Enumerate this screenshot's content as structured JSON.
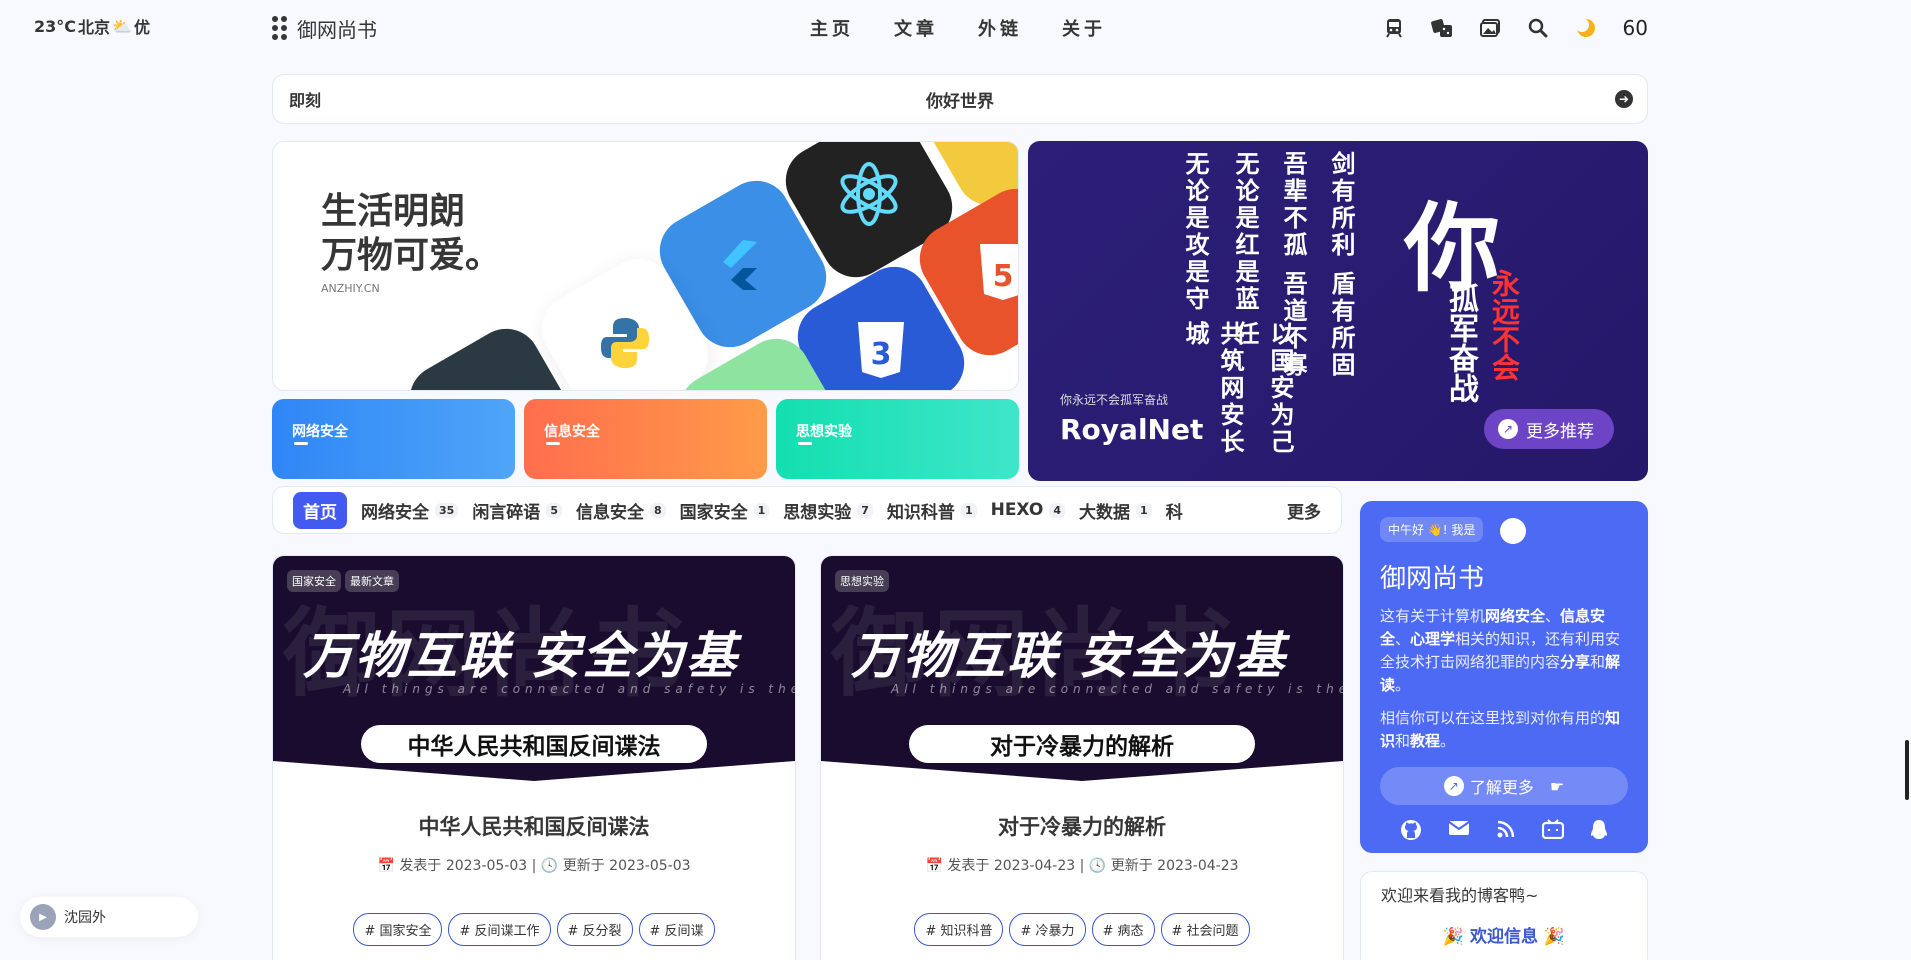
{
  "weather": {
    "temp": "23°C",
    "city": "北京",
    "aqi": "优"
  },
  "nav": {
    "brand": "御网尚书",
    "menu": [
      "主页",
      "文章",
      "外链",
      "关于"
    ],
    "count": "60"
  },
  "notice": {
    "label": "即刻",
    "message": "你好世界"
  },
  "hero": {
    "title_line1": "生活明朗",
    "title_line2": "万物可爱。",
    "site": "ANZHIY.CN"
  },
  "quick_cats": [
    {
      "label": "网络安全",
      "color": "#3a8ff7"
    },
    {
      "label": "信息安全",
      "color": "#ff7a45"
    },
    {
      "label": "思想实验",
      "color": "#1ed8b0"
    }
  ],
  "banner": {
    "poem": [
      "剑有所利",
      "盾有所固",
      "吾辈不孤",
      "吾道不寡",
      "无论是红是蓝",
      "以国安为己任",
      "无论是攻是守",
      "共筑网安长城"
    ],
    "headline_main": "你",
    "headline_side": "孤军奋战",
    "headline_red": "永远不会",
    "small": "你永远不会孤军奋战",
    "big": "RoyalNet",
    "more": "更多推荐"
  },
  "categories": [
    {
      "label": "首页",
      "count": ""
    },
    {
      "label": "网络安全",
      "count": "35"
    },
    {
      "label": "闲言碎语",
      "count": "5"
    },
    {
      "label": "信息安全",
      "count": "8"
    },
    {
      "label": "国家安全",
      "count": "1"
    },
    {
      "label": "思想实验",
      "count": "7"
    },
    {
      "label": "知识科普",
      "count": "1"
    },
    {
      "label": "HEXO",
      "count": "4"
    },
    {
      "label": "大数据",
      "count": "1"
    },
    {
      "label": "科",
      "count": ""
    }
  ],
  "categories_more": "更多",
  "posts": [
    {
      "badges": [
        "国家安全",
        "最新文章"
      ],
      "cover_ghost": "御网尚书",
      "cover_slogan": "万物互联 安全为基",
      "cover_sub": "All things are connected and safety is the foundation",
      "cover_pill": "中华人民共和国反间谍法",
      "title": "中华人民共和国反间谍法",
      "published_label": "发表于",
      "published": "2023-05-03",
      "updated_label": "更新于",
      "updated": "2023-05-03",
      "tags": [
        "# 国家安全",
        "# 反间谍工作",
        "# 反分裂",
        "# 反间谍"
      ]
    },
    {
      "badges": [
        "思想实验"
      ],
      "cover_ghost": "御网尚书",
      "cover_slogan": "万物互联 安全为基",
      "cover_sub": "All things are connected and safety is the foundation",
      "cover_pill": "对于冷暴力的解析",
      "title": "对于冷暴力的解析",
      "published_label": "发表于",
      "published": "2023-04-23",
      "updated_label": "更新于",
      "updated": "2023-04-23",
      "tags": [
        "# 知识科普",
        "# 冷暴力",
        "# 病态",
        "# 社会问题"
      ]
    }
  ],
  "profile": {
    "greeting": "中午好 👋! 我是",
    "name": "御网尚书",
    "desc1_a": "这有关于计算机",
    "desc1_b": "网络安全",
    "desc1_c": "、",
    "desc1_d": "信息安全",
    "desc1_e": "、",
    "desc1_f": "心理学",
    "desc1_g": "相关的知识，还有利用安全技术打击网络犯罪的内容",
    "desc1_h": "分享",
    "desc1_i": "和",
    "desc1_j": "解读",
    "desc1_k": "。",
    "desc2_a": "相信你可以在这里找到对你有用的",
    "desc2_b": "知识",
    "desc2_c": "和",
    "desc2_d": "教程",
    "desc2_e": "。",
    "learn_more": "了解更多"
  },
  "welcome": {
    "title": "欢迎来看我的博客鸭~",
    "info": "🎉 欢迎信息 🎉"
  },
  "music": {
    "song": "沈园外"
  }
}
